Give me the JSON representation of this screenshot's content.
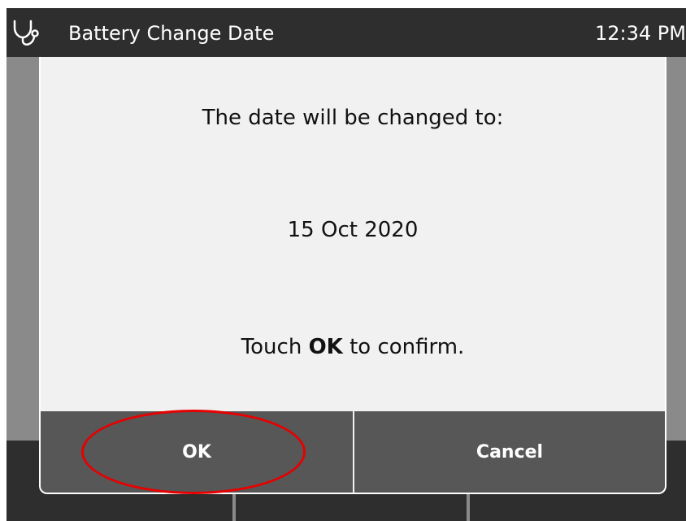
{
  "header": {
    "icon": "stethoscope-icon",
    "title": "Battery Change Date",
    "time": "12:34 PM"
  },
  "dialog": {
    "line1": "The date will be changed to:",
    "date": "15 Oct 2020",
    "confirm_prefix": "Touch ",
    "confirm_bold": "OK",
    "confirm_suffix": " to confirm.",
    "ok_label": "OK",
    "cancel_label": "Cancel"
  },
  "colors": {
    "header_bg": "#2e2e2e",
    "dialog_bg": "#f1f1f1",
    "button_bg": "#575757",
    "highlight": "#e60000"
  }
}
